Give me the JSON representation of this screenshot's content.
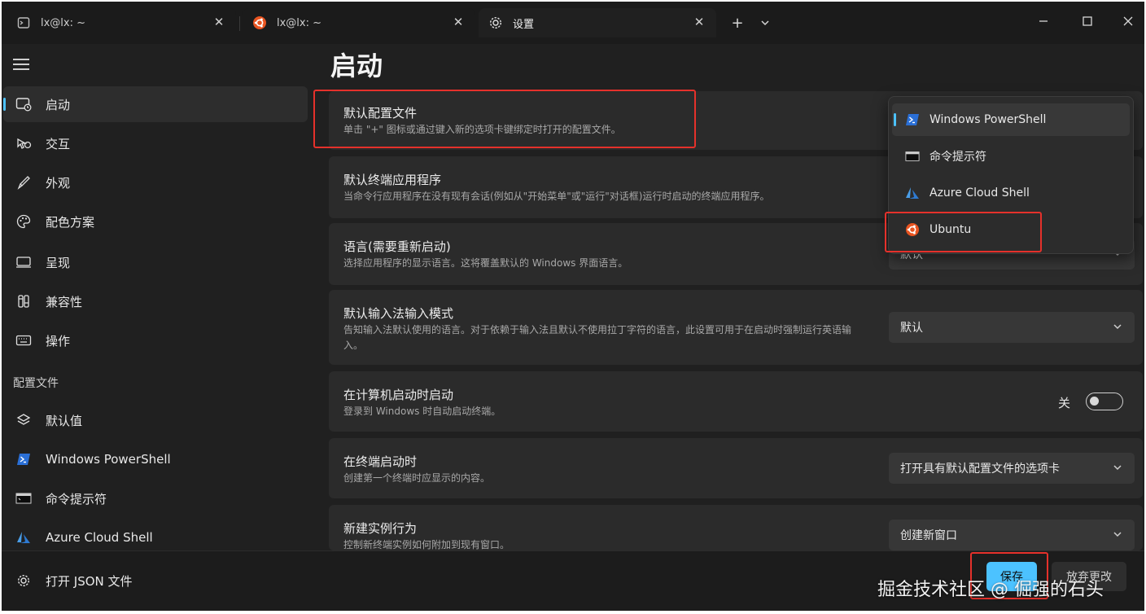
{
  "tabs": [
    {
      "label": "lx@lx: ~",
      "icon": "terminal-icon"
    },
    {
      "label": "lx@lx: ~",
      "icon": "ubuntu-icon"
    },
    {
      "label": "设置",
      "icon": "gear-icon",
      "active": true
    }
  ],
  "titlebar": {
    "new_tab": "+",
    "dropdown": "⌄"
  },
  "sidebar": {
    "items": [
      {
        "label": "启动",
        "icon": "startup-icon",
        "selected": true
      },
      {
        "label": "交互",
        "icon": "interaction-icon"
      },
      {
        "label": "外观",
        "icon": "brush-icon"
      },
      {
        "label": "配色方案",
        "icon": "palette-icon"
      },
      {
        "label": "呈现",
        "icon": "monitor-icon"
      },
      {
        "label": "兼容性",
        "icon": "compatibility-icon"
      },
      {
        "label": "操作",
        "icon": "keyboard-icon"
      }
    ],
    "profiles_header": "配置文件",
    "profiles": [
      {
        "label": "默认值",
        "icon": "layers-icon"
      },
      {
        "label": "Windows PowerShell",
        "icon": "powershell-icon"
      },
      {
        "label": "命令提示符",
        "icon": "cmd-icon"
      },
      {
        "label": "Azure Cloud Shell",
        "icon": "azure-icon"
      }
    ],
    "footer_link": "打开 JSON 文件"
  },
  "main": {
    "title": "启动",
    "cards": [
      {
        "title": "默认配置文件",
        "desc": "单击 \"+\" 图标或通过键入新的选项卡键绑定时打开的配置文件。"
      },
      {
        "title": "默认终端应用程序",
        "desc": "当命令行应用程序在没有现有会话(例如从\"开始菜单\"或\"运行\"对话框)运行时启动的终端应用程序。"
      },
      {
        "title": "语言(需要重新启动)",
        "desc": "选择应用程序的显示语言。这将覆盖默认的 Windows 界面语言。",
        "value": "默认"
      },
      {
        "title": "默认输入法输入模式",
        "desc": "告知输入法默认使用的语言。对于依赖于输入法且默认不使用拉丁字符的语言，此设置可用于在启动时强制运行英语输入。",
        "value": "默认"
      },
      {
        "title": "在计算机启动时启动",
        "desc": "登录到 Windows 时自动启动终端。",
        "toggle_label": "关",
        "toggle_on": false
      },
      {
        "title": "在终端启动时",
        "desc": "创建第一个终端时应显示的内容。",
        "value": "打开具有默认配置文件的选项卡"
      },
      {
        "title": "新建实例行为",
        "desc": "控制新终端实例如何附加到现有窗口。",
        "value": "创建新窗口"
      }
    ]
  },
  "popup": {
    "options": [
      {
        "label": "Windows PowerShell",
        "icon": "powershell-icon",
        "selected": true
      },
      {
        "label": "命令提示符",
        "icon": "cmd-icon"
      },
      {
        "label": "Azure Cloud Shell",
        "icon": "azure-icon"
      },
      {
        "label": "Ubuntu",
        "icon": "ubuntu-icon"
      }
    ]
  },
  "buttons": {
    "save": "保存",
    "discard": "放弃更改"
  },
  "watermark": "掘金技术社区 @ 倔强的石头",
  "colors": {
    "accent": "#4cc2ff",
    "highlight": "#e5312b",
    "ubuntu": "#e95420",
    "powershell": "#2a6fd6"
  }
}
